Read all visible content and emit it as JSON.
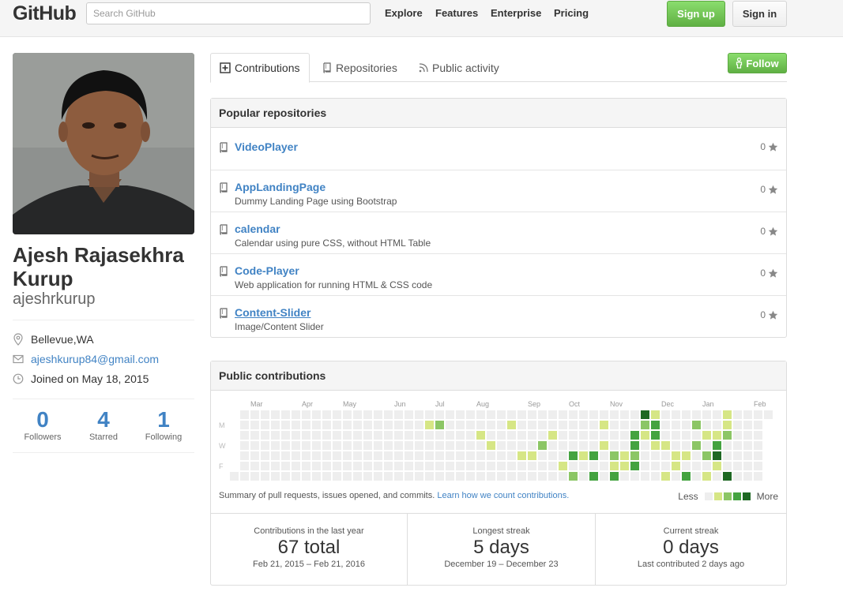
{
  "header": {
    "logo": "GitHub",
    "search_placeholder": "Search GitHub",
    "nav": [
      "Explore",
      "Features",
      "Enterprise",
      "Pricing"
    ],
    "signup_label": "Sign up",
    "signin_label": "Sign in"
  },
  "profile": {
    "name_line1": "Ajesh Rajasekhra",
    "name_line2": "Kurup",
    "username": "ajeshrkurup",
    "location": "Bellevue,WA",
    "email": "ajeshkurup84@gmail.com",
    "joined": "Joined on May 18, 2015",
    "stats": [
      {
        "value": "0",
        "label": "Followers"
      },
      {
        "value": "4",
        "label": "Starred"
      },
      {
        "value": "1",
        "label": "Following"
      }
    ]
  },
  "tabs": [
    "Contributions",
    "Repositories",
    "Public activity"
  ],
  "follow_label": "Follow",
  "popular": {
    "title": "Popular repositories",
    "repos": [
      {
        "name": "VideoPlayer",
        "desc": "",
        "stars": "0"
      },
      {
        "name": "AppLandingPage",
        "desc": "Dummy Landing Page using Bootstrap",
        "stars": "0"
      },
      {
        "name": "calendar",
        "desc": "Calendar using pure CSS, without HTML Table",
        "stars": "0"
      },
      {
        "name": "Code-Player",
        "desc": "Web application for running HTML & CSS code",
        "stars": "0"
      },
      {
        "name": "Content-Slider",
        "desc": "Image/Content Slider",
        "stars": "0"
      }
    ]
  },
  "contributions": {
    "title": "Public contributions",
    "months": [
      "Mar",
      "Apr",
      "May",
      "Jun",
      "Jul",
      "Aug",
      "Sep",
      "Oct",
      "Nov",
      "Dec",
      "Jan",
      "Feb"
    ],
    "day_labels": [
      "M",
      "W",
      "F"
    ],
    "summary_text": "Summary of pull requests, issues opened, and commits.",
    "summary_link": "Learn how we count contributions.",
    "legend_less": "Less",
    "legend_more": "More",
    "colors": [
      "#eeeeee",
      "#d6e685",
      "#8cc665",
      "#44a340",
      "#1e6823"
    ],
    "cells": [
      [
        40,
        0,
        4
      ],
      [
        40,
        1,
        2
      ],
      [
        40,
        2,
        1
      ],
      [
        41,
        0,
        1
      ],
      [
        41,
        1,
        3
      ],
      [
        41,
        2,
        3
      ],
      [
        41,
        3,
        1
      ],
      [
        48,
        0,
        1
      ],
      [
        48,
        1,
        1
      ],
      [
        48,
        2,
        2
      ],
      [
        48,
        6,
        4
      ],
      [
        47,
        3,
        3
      ],
      [
        47,
        4,
        4
      ],
      [
        47,
        5,
        1
      ],
      [
        45,
        1,
        2
      ],
      [
        45,
        3,
        2
      ],
      [
        46,
        2,
        1
      ],
      [
        46,
        4,
        2
      ],
      [
        46,
        6,
        1
      ],
      [
        44,
        4,
        1
      ],
      [
        42,
        3,
        1
      ],
      [
        43,
        4,
        1
      ],
      [
        39,
        2,
        3
      ],
      [
        39,
        3,
        3
      ],
      [
        39,
        4,
        2
      ],
      [
        39,
        5,
        3
      ],
      [
        38,
        4,
        1
      ],
      [
        38,
        5,
        1
      ],
      [
        37,
        4,
        2
      ],
      [
        37,
        5,
        1
      ],
      [
        37,
        6,
        3
      ],
      [
        36,
        1,
        1
      ],
      [
        36,
        3,
        1
      ],
      [
        35,
        4,
        3
      ],
      [
        35,
        6,
        3
      ],
      [
        34,
        4,
        1
      ],
      [
        33,
        4,
        3
      ],
      [
        33,
        6,
        2
      ],
      [
        31,
        2,
        1
      ],
      [
        30,
        3,
        2
      ],
      [
        32,
        5,
        1
      ],
      [
        28,
        4,
        1
      ],
      [
        27,
        1,
        1
      ],
      [
        25,
        3,
        1
      ],
      [
        24,
        2,
        1
      ],
      [
        20,
        1,
        2
      ],
      [
        19,
        1,
        1
      ],
      [
        42,
        6,
        1
      ],
      [
        44,
        6,
        3
      ],
      [
        43,
        5,
        1
      ],
      [
        29,
        4,
        1
      ],
      [
        47,
        2,
        1
      ]
    ],
    "stats": [
      {
        "title": "Contributions in the last year",
        "value": "67 total",
        "sub": "Feb 21, 2015 – Feb 21, 2016"
      },
      {
        "title": "Longest streak",
        "value": "5 days",
        "sub": "December 19 – December 23"
      },
      {
        "title": "Current streak",
        "value": "0 days",
        "sub": "Last contributed 2 days ago"
      }
    ]
  }
}
